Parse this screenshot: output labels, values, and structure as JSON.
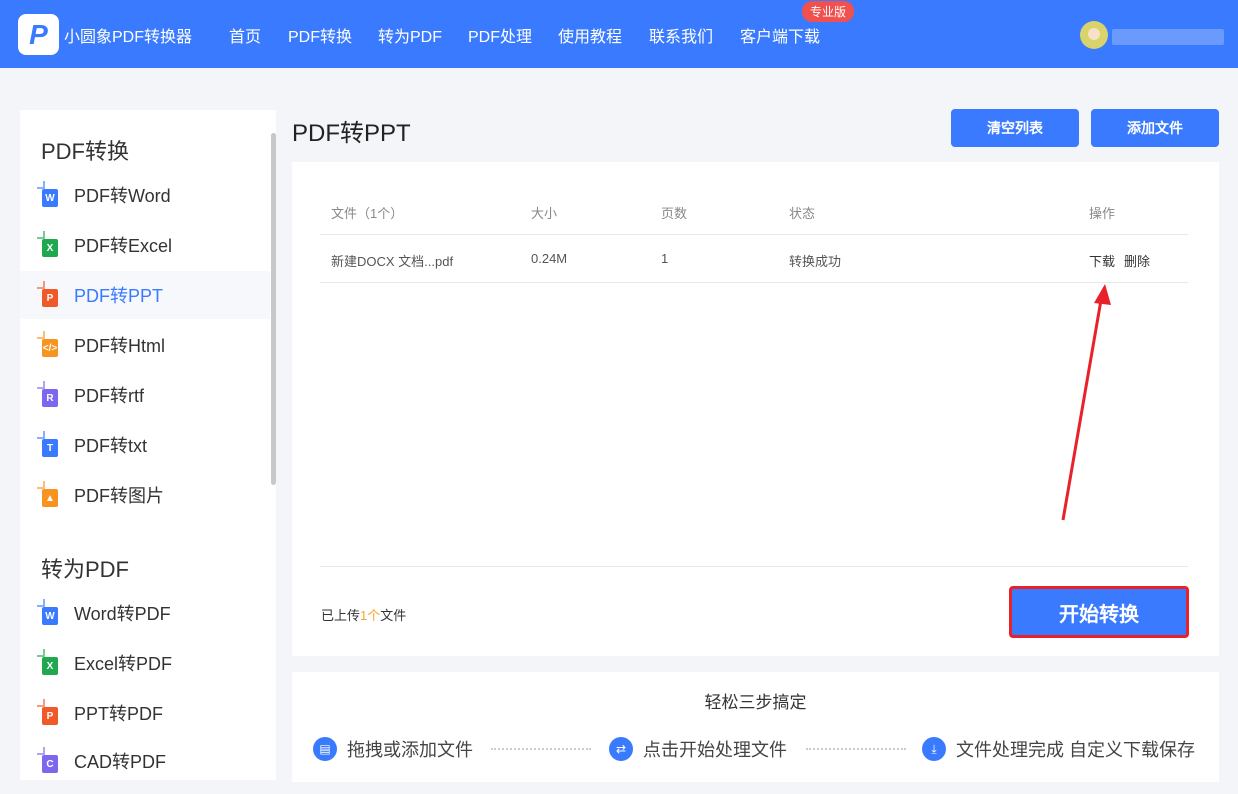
{
  "header": {
    "brand": "小圆象PDF转换器",
    "nav": [
      "首页",
      "PDF转换",
      "转为PDF",
      "PDF处理",
      "使用教程",
      "联系我们",
      "客户端下载"
    ],
    "badge": "专业版"
  },
  "sidebar": {
    "sections": [
      {
        "title": "PDF转换",
        "items": [
          {
            "label": "PDF转Word",
            "icon": "word-icon",
            "letter": "W",
            "color": "#3a7afe"
          },
          {
            "label": "PDF转Excel",
            "icon": "excel-icon",
            "letter": "X",
            "color": "#1fa84f"
          },
          {
            "label": "PDF转PPT",
            "icon": "ppt-icon",
            "letter": "P",
            "color": "#f05a28"
          },
          {
            "label": "PDF转Html",
            "icon": "html-icon",
            "letter": "</>",
            "color": "#f7931e"
          },
          {
            "label": "PDF转rtf",
            "icon": "rtf-icon",
            "letter": "R",
            "color": "#7b68ee"
          },
          {
            "label": "PDF转txt",
            "icon": "txt-icon",
            "letter": "T",
            "color": "#3a7afe"
          },
          {
            "label": "PDF转图片",
            "icon": "image-icon",
            "letter": "▲",
            "color": "#f7931e"
          }
        ]
      },
      {
        "title": "转为PDF",
        "items": [
          {
            "label": "Word转PDF",
            "icon": "word-icon",
            "letter": "W",
            "color": "#3a7afe"
          },
          {
            "label": "Excel转PDF",
            "icon": "excel-icon",
            "letter": "X",
            "color": "#1fa84f"
          },
          {
            "label": "PPT转PDF",
            "icon": "ppt-icon",
            "letter": "P",
            "color": "#f05a28"
          },
          {
            "label": "CAD转PDF",
            "icon": "cad-icon",
            "letter": "C",
            "color": "#7b68ee"
          }
        ]
      }
    ]
  },
  "main": {
    "title": "PDF转PPT",
    "clear_label": "清空列表",
    "add_label": "添加文件",
    "columns": [
      "文件（1个）",
      "大小",
      "页数",
      "状态",
      "操作"
    ],
    "rows": [
      {
        "name": "新建DOCX 文档...pdf",
        "size": "0.24M",
        "pages": "1",
        "status": "转换成功",
        "download": "下载",
        "delete": "删除"
      }
    ],
    "uploaded_prefix": "已上传",
    "uploaded_count": "1个",
    "uploaded_suffix": "文件",
    "start_label": "开始转换"
  },
  "steps": {
    "title": "轻松三步搞定",
    "items": [
      "拖拽或添加文件",
      "点击开始处理文件",
      "文件处理完成 自定义下载保存"
    ]
  },
  "colors": {
    "accent": "#3a7afe",
    "annotation": "#e8212a"
  }
}
